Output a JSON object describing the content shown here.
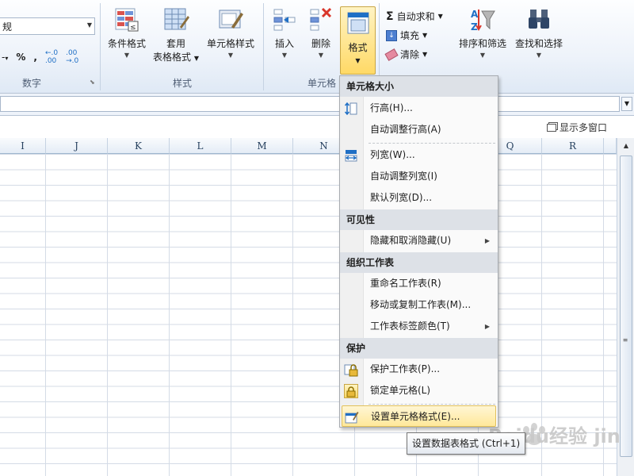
{
  "ribbon": {
    "number_format_value": "规",
    "number_buttons": [
      "-",
      "%",
      ","
    ],
    "number_group_label": "数字",
    "styles_group_label": "样式",
    "cells_group_label": "单元格",
    "conditional_format_label": "条件格式",
    "table_format_label_1": "套用",
    "table_format_label_2": "表格格式",
    "cell_styles_label": "单元格样式",
    "insert_label": "插入",
    "delete_label": "删除",
    "format_label": "格式",
    "autosum_label": "自动求和",
    "fill_label": "填充",
    "clear_label": "清除",
    "sort_filter_label": "排序和筛选",
    "find_select_label": "查找和选择"
  },
  "window": {
    "multi_window_label": "显示多窗口"
  },
  "columns": [
    "I",
    "J",
    "K",
    "L",
    "M",
    "N",
    "Q",
    "R"
  ],
  "menu": {
    "sections": [
      {
        "header": "单元格大小",
        "items": [
          "行高(H)...",
          "自动调整行高(A)",
          "列宽(W)...",
          "自动调整列宽(I)",
          "默认列宽(D)..."
        ]
      },
      {
        "header": "可见性",
        "items": [
          "隐藏和取消隐藏(U)"
        ]
      },
      {
        "header": "组织工作表",
        "items": [
          "重命名工作表(R)",
          "移动或复制工作表(M)...",
          "工作表标签颜色(T)"
        ]
      },
      {
        "header": "保护",
        "items": [
          "保护工作表(P)...",
          "锁定单元格(L)",
          "设置单元格格式(E)..."
        ]
      }
    ]
  },
  "tooltip": "设置数据表格式 (Ctrl+1)",
  "watermark": "Baidu经验 jingyan.baidu.com",
  "colors": {
    "highlight": "#ffe89a",
    "menu_header": "#dde1e7",
    "accent": "#1f6fc5"
  }
}
